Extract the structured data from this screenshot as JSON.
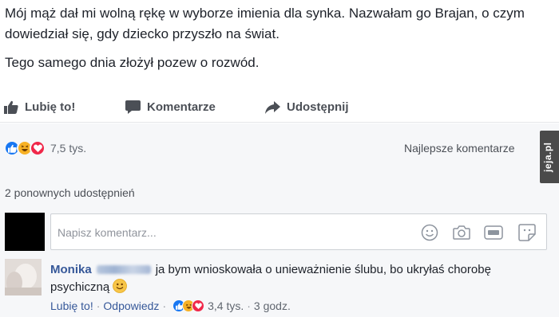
{
  "post": {
    "paragraphs": [
      "Mój mąż dał mi wolną rękę w wyborze imienia dla synka. Nazwałam go Brajan, o czym dowiedział się, gdy dziecko przyszło na świat.",
      "Tego samego dnia złożył pozew o rozwód."
    ]
  },
  "actions": {
    "like": "Lubię to!",
    "comment": "Komentarze",
    "share": "Udostępnij"
  },
  "reactions": {
    "types": [
      "like-icon",
      "haha-icon",
      "love-icon"
    ],
    "count": "7,5 tys."
  },
  "sort_label": "Najlepsze komentarze",
  "watermark": "jeja.pl",
  "shares": "2 ponownych udostępnień",
  "composer": {
    "placeholder": "Napisz komentarz...",
    "icons": [
      "emoji-icon",
      "camera-icon",
      "gif-icon",
      "sticker-icon"
    ]
  },
  "comment": {
    "author": "Monika",
    "text": "ja bym wnioskowała o unieważnienie ślubu, bo ukryłaś chorobę psychiczną",
    "emoji": "smiley-icon",
    "like": "Lubię to!",
    "reply": "Odpowiedz",
    "reactions": [
      "like-icon",
      "haha-icon",
      "love-icon"
    ],
    "reaction_count": "3,4 tys.",
    "time": "3 godz."
  },
  "colors": {
    "link": "#365899",
    "like": "#1877f2",
    "haha": "#f7b125",
    "love": "#f0284a",
    "background": "#f6f7f9"
  }
}
